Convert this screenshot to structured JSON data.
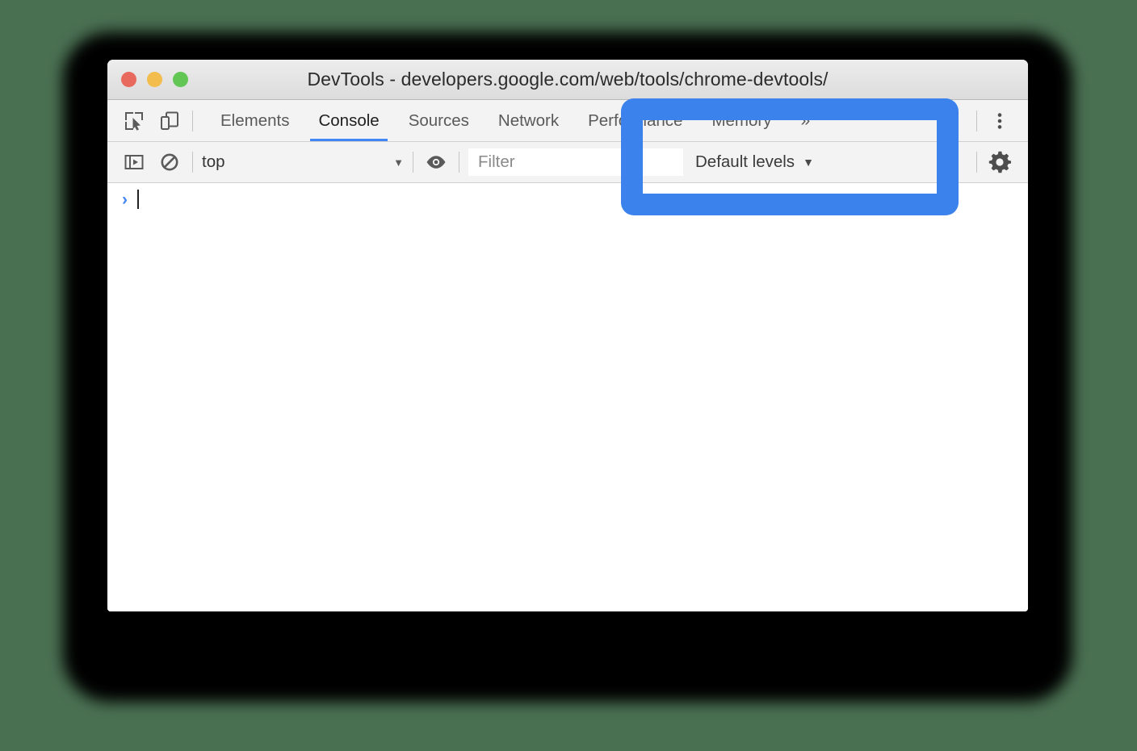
{
  "window": {
    "title": "DevTools - developers.google.com/web/tools/chrome-devtools/",
    "traffic_lights": [
      {
        "name": "close",
        "color": "#e8695e"
      },
      {
        "name": "minimize",
        "color": "#f2bd4c"
      },
      {
        "name": "zoom",
        "color": "#62c655"
      }
    ]
  },
  "tabbar": {
    "icons": [
      {
        "name": "inspect-element-icon",
        "title": "Inspect element"
      },
      {
        "name": "device-toolbar-icon",
        "title": "Toggle device toolbar"
      }
    ],
    "tabs": [
      {
        "label": "Elements",
        "active": false
      },
      {
        "label": "Console",
        "active": true
      },
      {
        "label": "Sources",
        "active": false
      },
      {
        "label": "Network",
        "active": false
      },
      {
        "label": "Performance",
        "active": false
      },
      {
        "label": "Memory",
        "active": false
      },
      {
        "label": "»",
        "active": false
      }
    ],
    "more_options_label": "⋮"
  },
  "filterbar": {
    "sidebar_toggle_icon": "show-console-sidebar-icon",
    "clear_console_icon": "clear-console-icon",
    "context": {
      "value": "top",
      "caret": "▼"
    },
    "eye_icon": "live-expression-eye-icon",
    "filter": {
      "value": "",
      "placeholder": "Filter"
    },
    "levels": {
      "value": "Default levels",
      "caret": "▼"
    },
    "settings_icon": "settings-gear-icon"
  },
  "console": {
    "prompt_chevron": "›",
    "prompt_value": ""
  },
  "annotation": {
    "highlight_color": "#3b82ec",
    "shape": "rounded-rectangle-outline"
  },
  "colors": {
    "background": "#4a7052",
    "accent_blue": "#4285f4",
    "toolbar_bg": "#f3f3f3",
    "titlebar_bg": "#e3e3e3"
  }
}
